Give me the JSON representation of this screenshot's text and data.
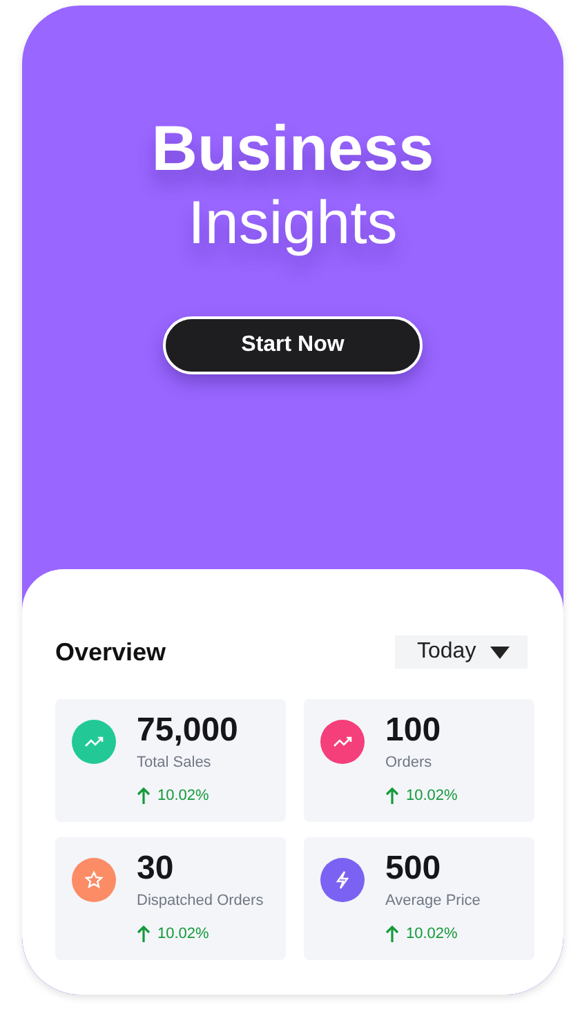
{
  "hero": {
    "title_bold": "Business",
    "title_light": "Insights",
    "button": "Start Now"
  },
  "overview": {
    "title": "Overview",
    "period": "Today",
    "stats": [
      {
        "value": "75,000",
        "label": "Total Sales",
        "change": "10.02%",
        "color": "#22c997",
        "kind": "trend"
      },
      {
        "value": "100",
        "label": "Orders",
        "change": "10.02%",
        "color": "#f43f7a",
        "kind": "trend"
      },
      {
        "value": "30",
        "label": "Dispatched Orders",
        "change": "10.02%",
        "color": "#fb8c66",
        "kind": "star"
      },
      {
        "value": "500",
        "label": "Average Price",
        "change": "10.02%",
        "color": "#7c62f2",
        "kind": "bolt"
      }
    ]
  }
}
